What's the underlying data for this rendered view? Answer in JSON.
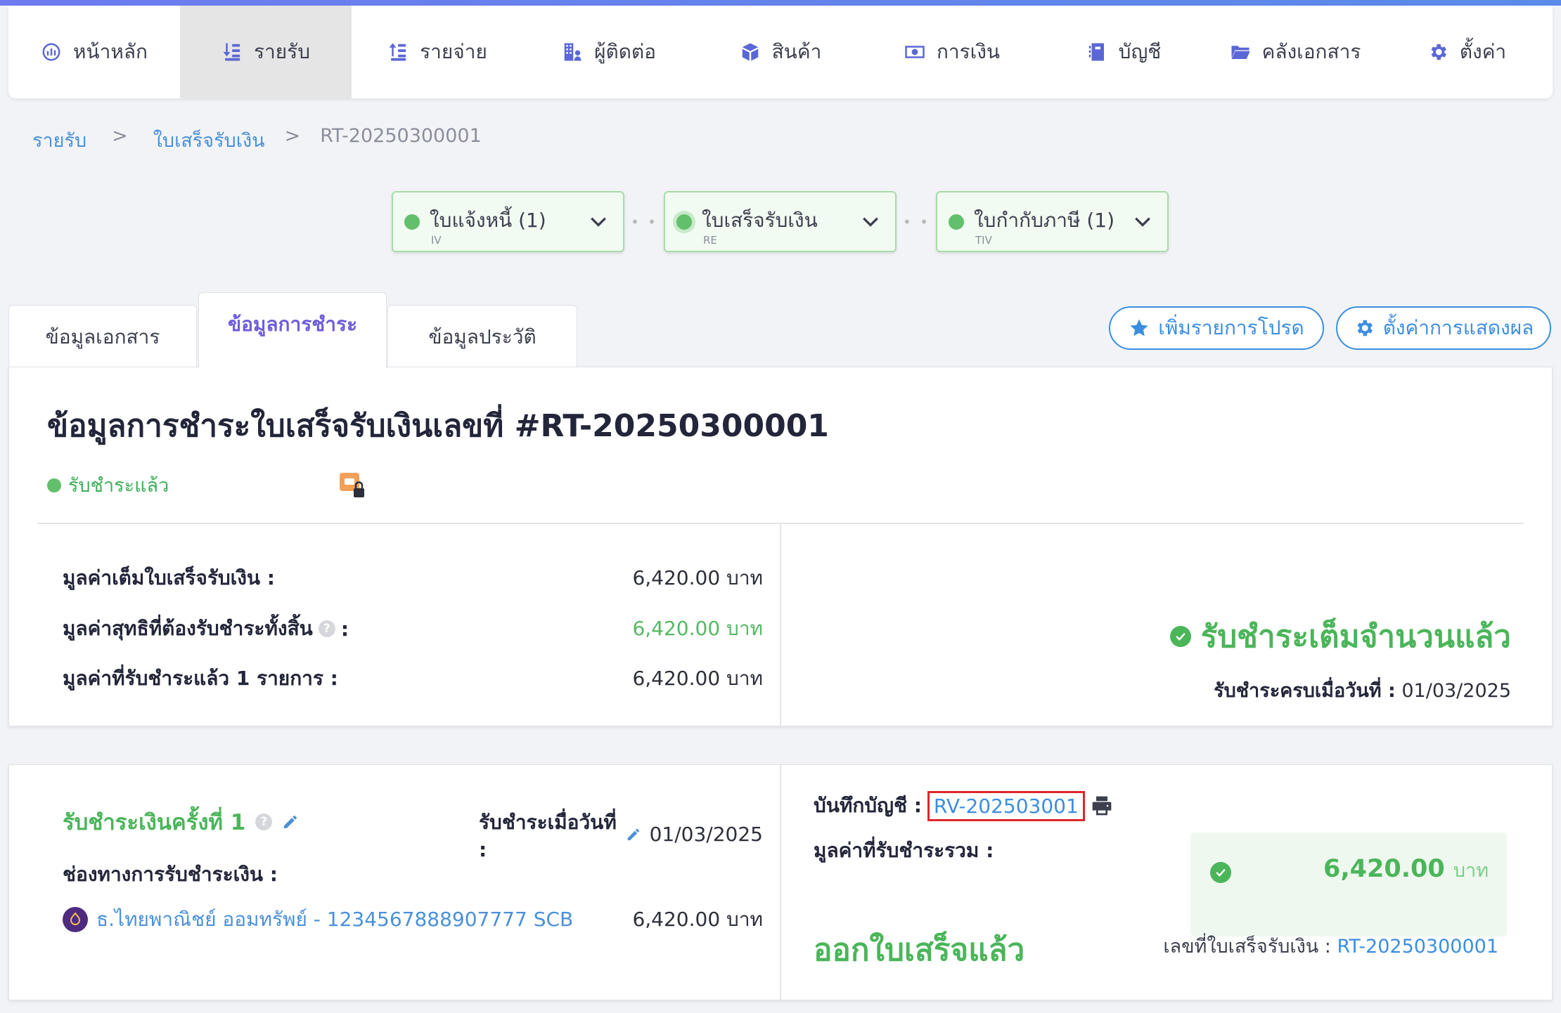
{
  "nav": {
    "items": [
      {
        "label": "หน้าหลัก",
        "icon": "dashboard-icon"
      },
      {
        "label": "รายรับ",
        "icon": "income-icon",
        "active": true
      },
      {
        "label": "รายจ่าย",
        "icon": "expense-icon"
      },
      {
        "label": "ผู้ติดต่อ",
        "icon": "contacts-icon"
      },
      {
        "label": "สินค้า",
        "icon": "product-box-icon"
      },
      {
        "label": "การเงิน",
        "icon": "money-icon"
      },
      {
        "label": "บัญชี",
        "icon": "ledger-book-icon"
      },
      {
        "label": "คลังเอกสาร",
        "icon": "folder-icon"
      },
      {
        "label": "ตั้งค่า",
        "icon": "gear-icon"
      }
    ]
  },
  "breadcrumb": {
    "level1": "รายรับ",
    "level2": "ใบเสร็จรับเงิน",
    "current": "RT-20250300001",
    "sep": ">"
  },
  "flow": {
    "sep": "• • •",
    "steps": [
      {
        "label": "ใบแจ้งหนี้ (1)",
        "code": "IV"
      },
      {
        "label": "ใบเสร็จรับเงิน",
        "code": "RE"
      },
      {
        "label": "ใบกำกับภาษี (1)",
        "code": "TIV"
      }
    ]
  },
  "tabs": {
    "doc": "ข้อมูลเอกสาร",
    "payment": "ข้อมูลการชำระ",
    "history": "ข้อมูลประวัติ"
  },
  "actions": {
    "favorite": "เพิ่มรายการโปรด",
    "display_settings": "ตั้งค่าการแสดงผล"
  },
  "summary": {
    "title": "ข้อมูลการชำระใบเสร็จรับเงินเลขที่ #RT-20250300001",
    "status": "รับชำระแล้ว",
    "rows": [
      {
        "label": "มูลค่าเต็มใบเสร็จรับเงิน :",
        "value": "6,420.00 บาท"
      },
      {
        "label": "มูลค่าสุทธิที่ต้องรับชำระทั้งสิ้น",
        "suffix": ":",
        "help": "?",
        "value": "6,420.00 บาท"
      },
      {
        "label": "มูลค่าที่รับชำระแล้ว 1 รายการ :",
        "value": "6,420.00 บาท"
      }
    ],
    "full_paid": "รับชำระเต็มจำนวนแล้ว",
    "paid_on_label": "รับชำระครบเมื่อวันที่ :",
    "paid_on_value": "01/03/2025"
  },
  "payment": {
    "title": "รับชำระเงินครั้งที่ 1",
    "help": "?",
    "date_label": "รับชำระเมื่อวันที่ :",
    "date_value": "01/03/2025",
    "channel_label": "ช่องทางการรับชำระเงิน :",
    "bank_label": "ธ.ไทยพาณิชย์ ออมทรัพย์ - 1234567888907777 SCB",
    "bank_amount": "6,420.00 บาท",
    "ledger_label": "บันทึกบัญชี :",
    "ledger_number": "RV-202503001",
    "total_label": "มูลค่าที่รับชำระรวม :",
    "total_amount": "6,420.00",
    "total_unit": "บาท",
    "issued": "ออกใบเสร็จแล้ว",
    "receipt_label": "เลขที่ใบเสร็จรับเงิน :",
    "receipt_number": "RT-20250300001"
  },
  "colors": {
    "accent": "#5b67d6",
    "success": "#4bb55a",
    "link": "#3b8ee0",
    "highlight": "#e0262a"
  }
}
